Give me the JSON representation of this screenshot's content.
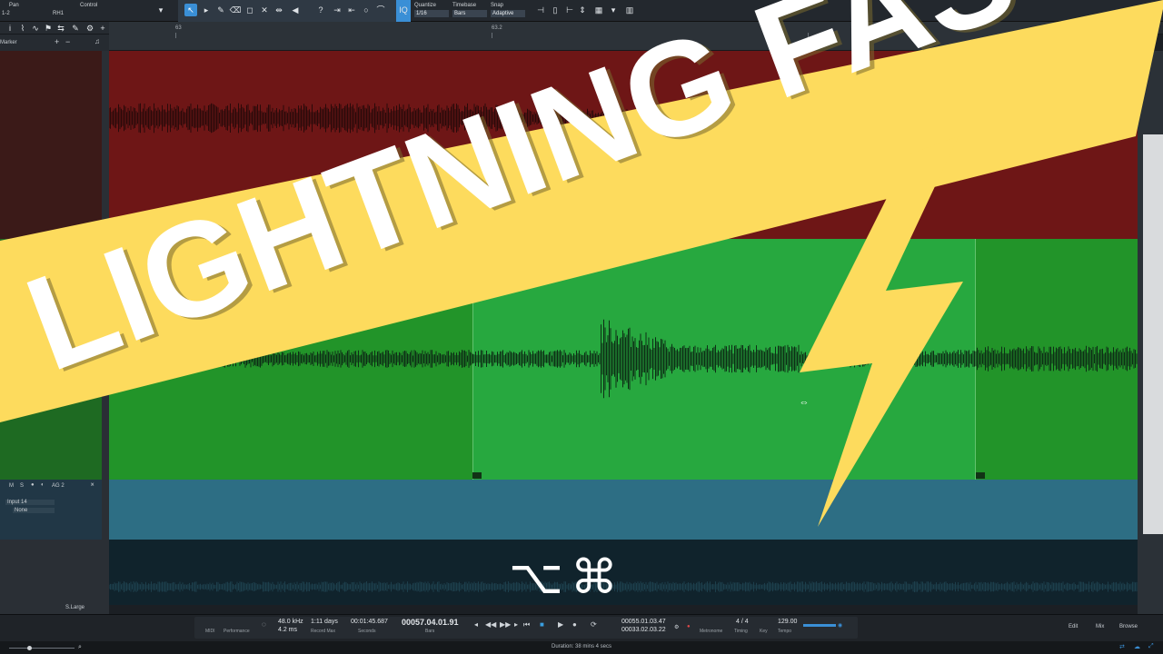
{
  "toolbar": {
    "param_name": "Pan",
    "channel": "1-2",
    "control_label": "Control",
    "control_value": "RH1",
    "quantize_label": "Quantize",
    "quantize_value": "1/16",
    "timebase_label": "Timebase",
    "timebase_value": "Bars",
    "snap_label": "Snap",
    "snap_value": "Adaptive"
  },
  "ruler": {
    "mark_1": "63",
    "mark_2": "63.2"
  },
  "tracks": {
    "marker_label": "Marker",
    "track_name": "AG 2",
    "input": "Input 14",
    "output": "None",
    "btn_m": "M",
    "btn_s": "S",
    "size_label": "S.Large"
  },
  "transport": {
    "sample_rate": "48.0 kHz",
    "latency": "4.2 ms",
    "midi_label": "MIDI",
    "performance_label": "Performance",
    "record_time": "1:11 days",
    "record_label": "Record Max",
    "seconds_value": "00:01:45.687",
    "seconds_label": "Seconds",
    "bars_value": "00057.04.01.91",
    "bars_label": "Bars",
    "loop_start": "00055.01.03.47",
    "loop_end": "00033.02.03.22",
    "metronome_label": "Metronome",
    "timing_value": "4 / 4",
    "timing_label": "Timing",
    "key_label": "Key",
    "tempo_value": "129.00",
    "tempo_label": "Tempo",
    "edit_label": "Edit",
    "mix_label": "Mix",
    "browse_label": "Browse"
  },
  "status": {
    "duration": "Duration: 38 mins 4 secs"
  },
  "overlay": {
    "headline": "LIGHTNING FAST",
    "shortcut": "⌥⌘",
    "banner_color": "#fddb5d",
    "text_color": "#ffffff"
  },
  "colors": {
    "track_red": "#6e1616",
    "track_green": "#229429",
    "track_teal": "#2d6e84",
    "accent": "#3a8fd6"
  }
}
